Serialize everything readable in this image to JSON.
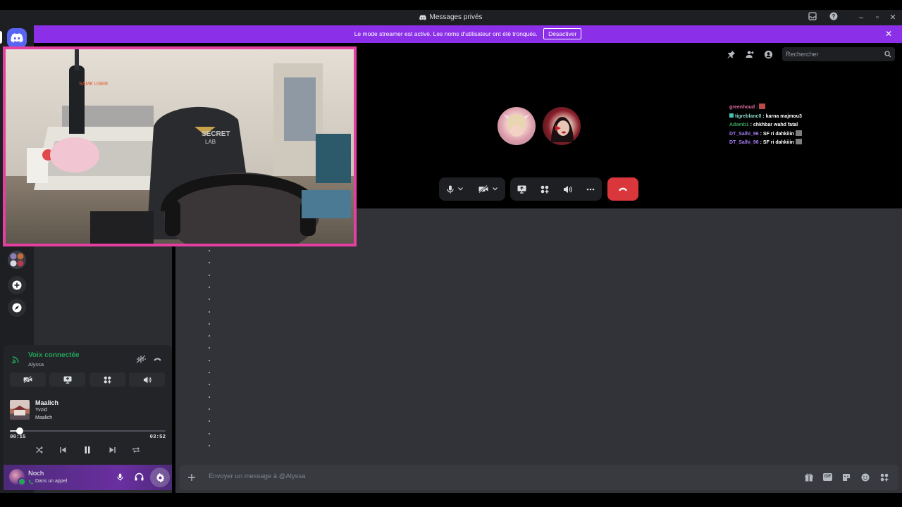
{
  "window": {
    "title": "Messages privés"
  },
  "banner": {
    "text": "Le mode streamer est activé. Les noms d'utilisateur ont été tronqués.",
    "button_label": "Désactiver",
    "close_label": "✕"
  },
  "header": {
    "search_placeholder": "Rechercher"
  },
  "chat_overlay": [
    {
      "user": "greenhoud",
      "text": " : ",
      "color": "#e06c9f"
    },
    {
      "user": "tigreblanc0",
      "text": " : karna majmou3",
      "color": "#8ad6c8"
    },
    {
      "user": "Adamb1",
      "text": " : chkhbar wahd fatal",
      "color": "#3ba55d"
    },
    {
      "user": "DT_Salhi_96",
      "text": " : SF ri dahkiiin",
      "color": "#a67cf2"
    },
    {
      "user": "DT_Salhi_96",
      "text": " : SF ri dahkiiin",
      "color": "#a67cf2"
    }
  ],
  "video": {
    "name_tag": "SAME USER"
  },
  "voice": {
    "status": "Voix connectée",
    "channel": "Alyssa",
    "status_color": "#23a55a"
  },
  "music": {
    "title": "Maalich",
    "artist": "Yvzid",
    "album": "Maalich",
    "elapsed": "00:15",
    "duration": "03:52",
    "progress": 0.065
  },
  "user": {
    "name": "Noch",
    "status": "Dans un appel"
  },
  "composer": {
    "placeholder": "Envoyer un message à @Alyssa"
  },
  "colors": {
    "accent": "#5865f2",
    "banner": "#8c2fe8",
    "hangup": "#da373c",
    "video_border": "#e53fa2"
  }
}
